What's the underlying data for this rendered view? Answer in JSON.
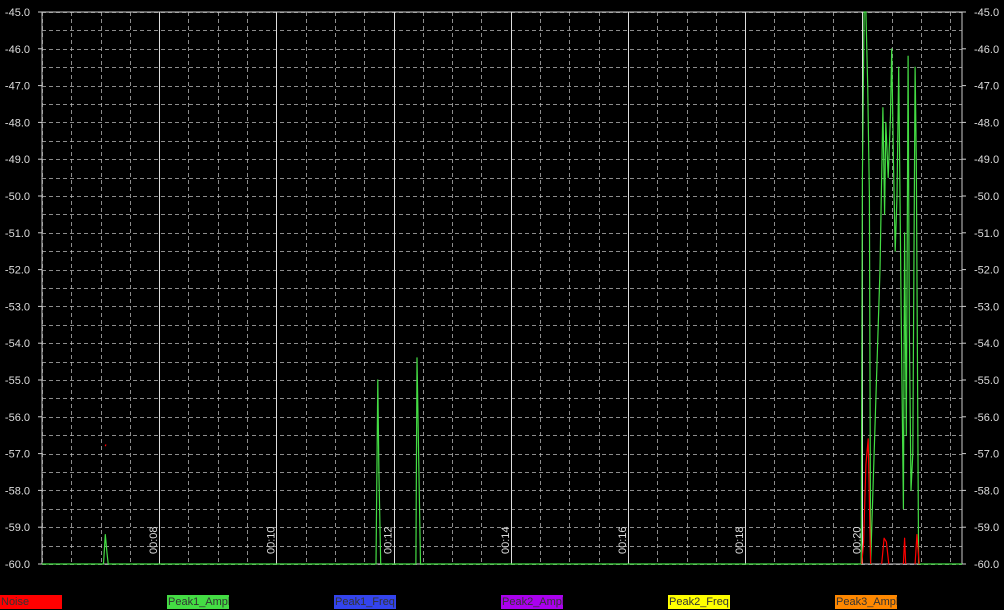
{
  "chart_data": {
    "type": "line",
    "ylim": [
      -60.0,
      -45.0
    ],
    "y_ticks": [
      "-45.0",
      "-46.0",
      "-47.0",
      "-48.0",
      "-49.0",
      "-50.0",
      "-51.0",
      "-52.0",
      "-53.0",
      "-54.0",
      "-55.0",
      "-56.0",
      "-57.0",
      "-58.0",
      "-59.0",
      "-60.0"
    ],
    "x_range_minutes": [
      6.0,
      21.7
    ],
    "x_ticks": [
      "00:08",
      "00:10",
      "00:12",
      "00:14",
      "00:16",
      "00:18",
      "00:20"
    ],
    "x_tick_minutes": [
      8,
      10,
      12,
      14,
      16,
      18,
      20
    ],
    "grid": true,
    "background": "#000000",
    "grid_color": "#ffffff",
    "series": [
      {
        "name": "Noise",
        "color": "#ff0000",
        "segments": [
          [
            [
              7.08,
              -56.8
            ],
            [
              7.09,
              -56.75
            ]
          ],
          [
            [
              19.99,
              -60.0
            ],
            [
              20.02,
              -59.4
            ],
            [
              20.06,
              -57.3
            ],
            [
              20.1,
              -56.6
            ],
            [
              20.14,
              -60.0
            ]
          ],
          [
            [
              20.33,
              -60.0
            ],
            [
              20.37,
              -59.3
            ],
            [
              20.41,
              -59.4
            ],
            [
              20.45,
              -60.0
            ]
          ],
          [
            [
              20.7,
              -60.0
            ],
            [
              20.72,
              -59.3
            ],
            [
              20.74,
              -60.0
            ]
          ],
          [
            [
              20.9,
              -60.0
            ],
            [
              20.93,
              -59.2
            ],
            [
              20.97,
              -60.0
            ]
          ]
        ]
      },
      {
        "name": "Peak1_Ampl",
        "color": "#44dd44",
        "segments": [
          [
            [
              6.0,
              -60.0
            ],
            [
              7.05,
              -60.0
            ],
            [
              7.08,
              -59.2
            ],
            [
              7.11,
              -59.7
            ],
            [
              7.13,
              -60.0
            ],
            [
              11.7,
              -60.0
            ],
            [
              11.73,
              -55.0
            ],
            [
              11.75,
              -57.5
            ],
            [
              11.78,
              -60.0
            ],
            [
              12.38,
              -60.0
            ],
            [
              12.4,
              -54.4
            ],
            [
              12.43,
              -57.3
            ],
            [
              12.46,
              -60.0
            ],
            [
              19.98,
              -60.0
            ],
            [
              20.0,
              -49.5
            ],
            [
              20.03,
              -45.0
            ],
            [
              20.06,
              -45.0
            ],
            [
              20.09,
              -47.0
            ],
            [
              20.12,
              -50.0
            ],
            [
              20.14,
              -60.0
            ],
            [
              20.3,
              -52.0
            ],
            [
              20.35,
              -47.6
            ],
            [
              20.38,
              -50.5
            ],
            [
              20.4,
              -48.0
            ],
            [
              20.44,
              -49.5
            ],
            [
              20.48,
              -47.8
            ],
            [
              20.5,
              -46.0
            ],
            [
              20.53,
              -49.0
            ],
            [
              20.56,
              -51.5
            ],
            [
              20.59,
              -50.0
            ],
            [
              20.62,
              -46.5
            ],
            [
              20.66,
              -53.0
            ],
            [
              20.7,
              -58.5
            ],
            [
              20.72,
              -51.0
            ],
            [
              20.75,
              -56.5
            ],
            [
              20.78,
              -46.2
            ],
            [
              20.8,
              -53.5
            ],
            [
              20.83,
              -58.0
            ],
            [
              20.86,
              -57.0
            ],
            [
              20.9,
              -46.5
            ],
            [
              20.92,
              -49.0
            ],
            [
              20.96,
              -60.0
            ],
            [
              21.7,
              -60.0
            ]
          ]
        ]
      },
      {
        "name": "Peak1_Freq",
        "color": "#3344ee",
        "segments": []
      },
      {
        "name": "Peak2_Ampl",
        "color": "#aa00ee",
        "segments": []
      },
      {
        "name": "Peak2_Freq",
        "color": "#ffff00",
        "segments": []
      },
      {
        "name": "Peak3_Ampl",
        "color": "#ff8800",
        "segments": []
      }
    ]
  }
}
